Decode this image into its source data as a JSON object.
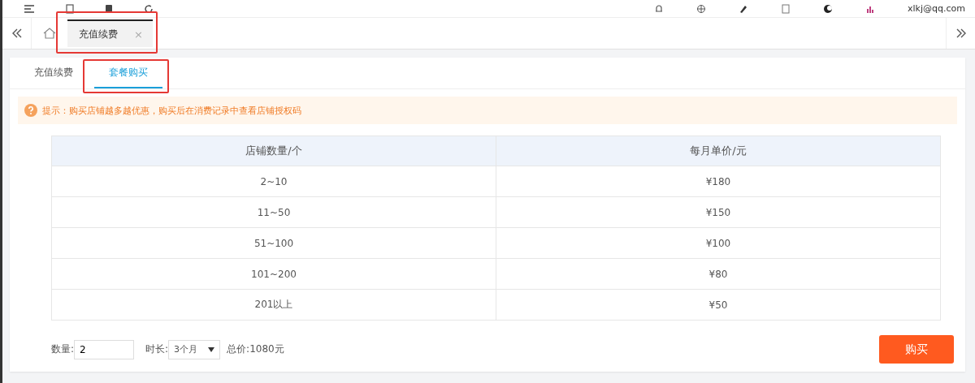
{
  "top_bar": {
    "user": "xlkj@qq.com"
  },
  "page_tabs": [
    {
      "label": "充值续费",
      "selected": true,
      "highlighted": true,
      "close": "×"
    }
  ],
  "tabs": [
    {
      "label": "充值续费",
      "selected": false,
      "highlighted": false
    },
    {
      "label": "套餐购买",
      "selected": true,
      "highlighted": true
    }
  ],
  "notice": "提示：购买店铺越多越优惠，购买后在消费记录中查看店铺授权码",
  "table": {
    "columns": [
      "店铺数量/个",
      "每月单价/元"
    ],
    "rows": [
      [
        "2~10",
        "¥180"
      ],
      [
        "11~50",
        "¥150"
      ],
      [
        "51~100",
        "¥100"
      ],
      [
        "101~200",
        "¥80"
      ],
      [
        "201以上",
        "¥50"
      ]
    ]
  },
  "form": {
    "quantity_label": "数量:",
    "quantity": "2",
    "duration_label": "时长:",
    "duration": "3个月",
    "total": "总价:1080元"
  },
  "buy_button": "购买"
}
